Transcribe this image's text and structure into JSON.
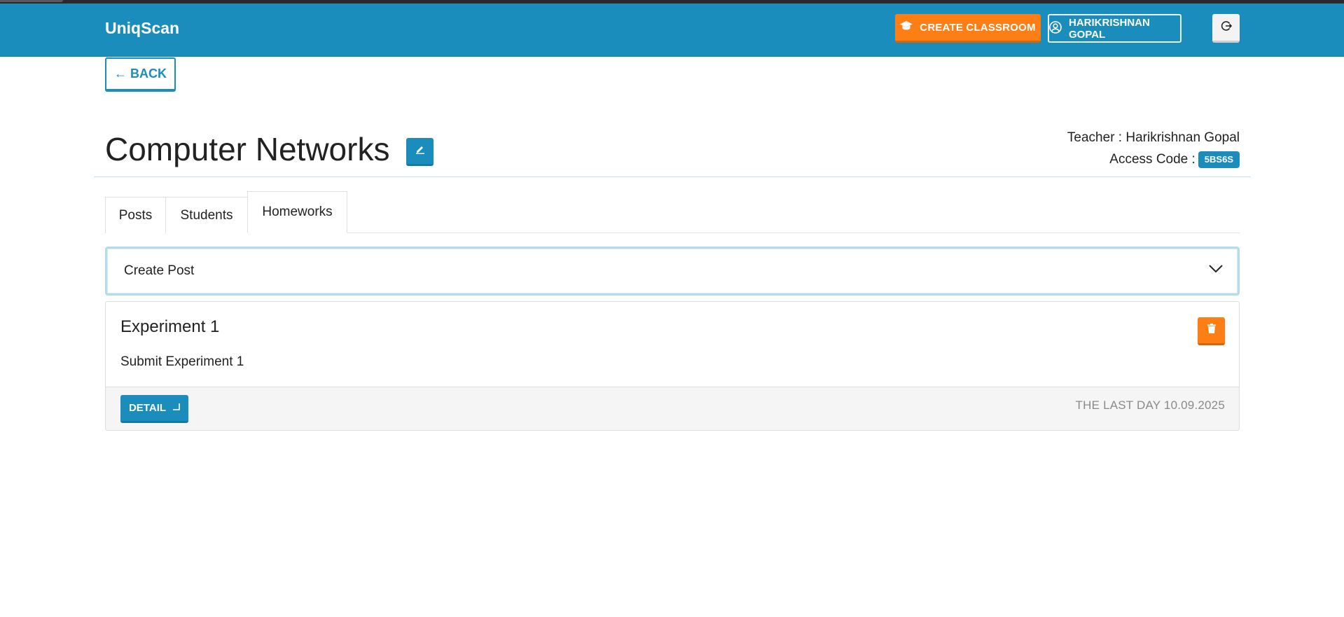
{
  "navbar": {
    "brand": "UniqScan",
    "create_classroom_label": "CREATE CLASSROOM",
    "user_label": "HARIKRISHNAN GOPAL"
  },
  "back_label": "← BACK",
  "classroom": {
    "title": "Computer Networks",
    "teacher_line": "Teacher : Harikrishnan Gopal",
    "access_code_label": "Access Code :",
    "access_code": "5BS6S"
  },
  "tabs": [
    {
      "label": "Posts",
      "active": false
    },
    {
      "label": "Students",
      "active": false
    },
    {
      "label": "Homeworks",
      "active": true
    }
  ],
  "create_post": {
    "label": "Create Post"
  },
  "homeworks": [
    {
      "title": "Experiment 1",
      "description": "Submit Experiment 1",
      "detail_label": "DETAIL",
      "due_text": "THE LAST DAY 10.09.2025"
    }
  ],
  "colors": {
    "primary": "#1a8dbd",
    "accent": "#fd7e14",
    "muted_text": "#8a8a8a"
  }
}
